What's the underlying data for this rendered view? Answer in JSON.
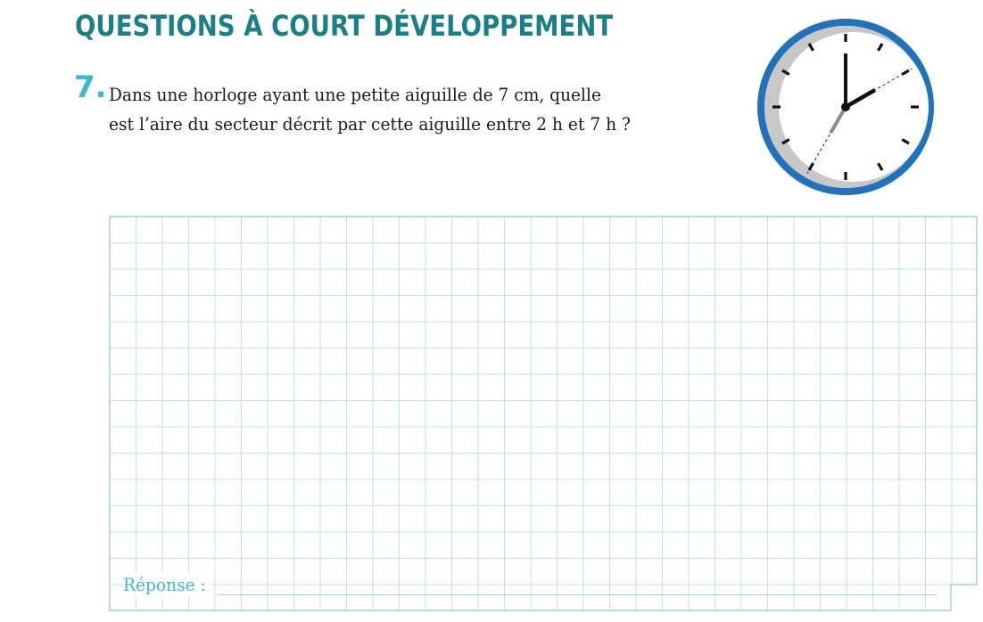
{
  "section": {
    "title": "QUESTIONS À COURT DÉVELOPPEMENT"
  },
  "question": {
    "number": "7.",
    "lines": [
      "Dans une horloge ayant une petite aiguille de 7 cm, quelle",
      "est l’aire du secteur décrit par cette aiguille entre 2 h et 7 h ?"
    ]
  },
  "clock": {
    "icon": "clock-icon",
    "hour_hand_hour": 2,
    "minute_hand_minute": 0,
    "swept_sector_hours": [
      2,
      7
    ]
  },
  "answer": {
    "label": "Réponse :"
  },
  "colors": {
    "title": "#1b7f86",
    "number": "#3bb8d2",
    "grid_line": "#bde3ee",
    "grid_border": "#8cc6d8",
    "answer_label": "#3bb8d2",
    "clock_rim": "#2072bb",
    "clock_shadow": "#c8c8c8",
    "hands": "#111111",
    "hand_gray": "#8a8a8a"
  }
}
